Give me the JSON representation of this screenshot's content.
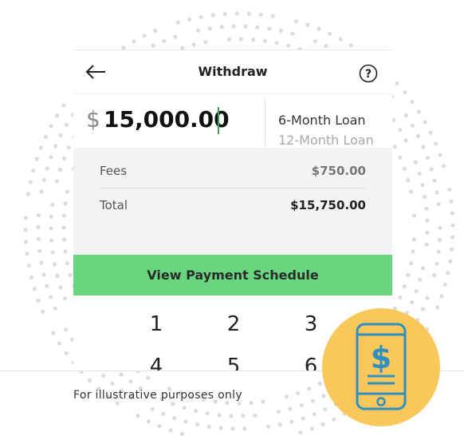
{
  "header": {
    "title": "Withdraw"
  },
  "amount": {
    "currency_symbol": "$",
    "value": "15,000.00"
  },
  "loan_options": [
    "6-Month Loan",
    "12-Month Loan"
  ],
  "summary": {
    "fees_label": "Fees",
    "fees_value": "$750.00",
    "total_label": "Total",
    "total_value": "$15,750.00"
  },
  "cta": {
    "label": "View Payment Schedule"
  },
  "keypad": {
    "keys": [
      "1",
      "2",
      "3",
      "4",
      "5",
      "6"
    ]
  },
  "caption": "For illustrative purposes only",
  "badge": {
    "icon_text": "$"
  },
  "colors": {
    "accent_green": "#69d67f",
    "badge_yellow": "#f9c75a",
    "icon_blue": "#2f8fc0",
    "dot_gray": "#dcdcdc"
  }
}
